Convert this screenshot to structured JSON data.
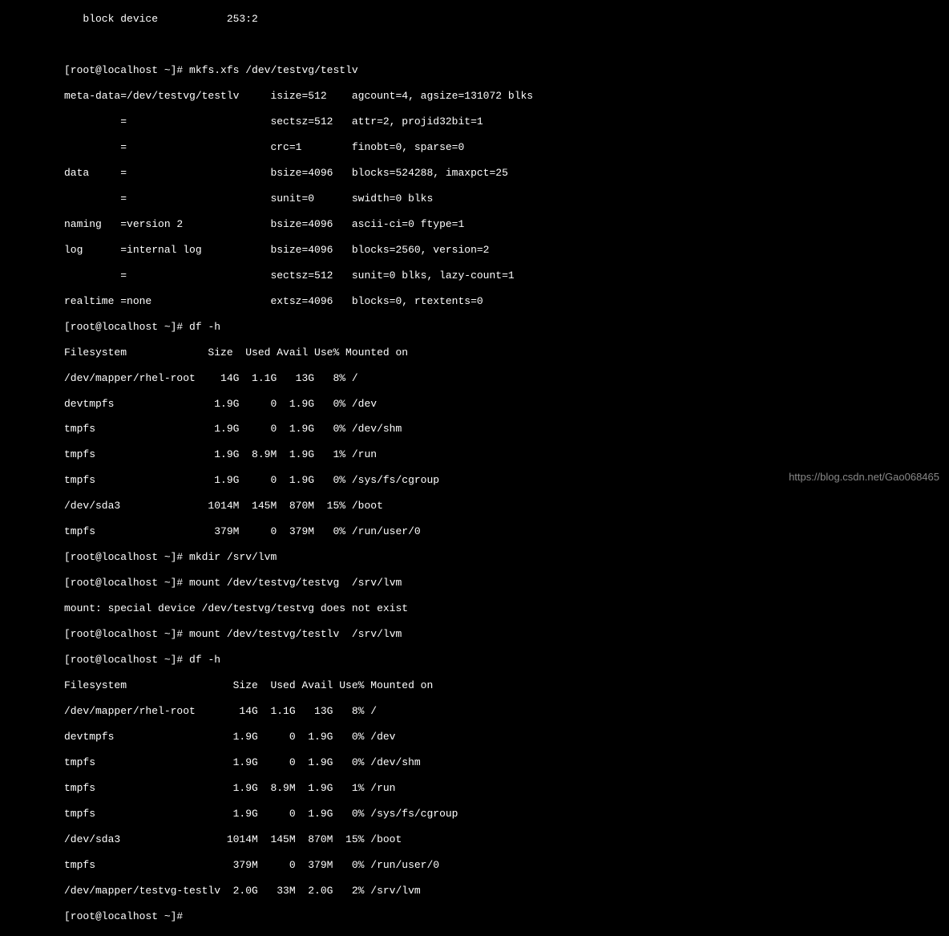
{
  "partial_top": "   block device           253:2",
  "prompt": "[root@localhost ~]#",
  "cmd1": "mkfs.xfs /dev/testvg/testlv",
  "mkfs": {
    "l1": "meta-data=/dev/testvg/testlv     isize=512    agcount=4, agsize=131072 blks",
    "l2": "         =                       sectsz=512   attr=2, projid32bit=1",
    "l3": "         =                       crc=1        finobt=0, sparse=0",
    "l4": "data     =                       bsize=4096   blocks=524288, imaxpct=25",
    "l5": "         =                       sunit=0      swidth=0 blks",
    "l6": "naming   =version 2              bsize=4096   ascii-ci=0 ftype=1",
    "l7": "log      =internal log           bsize=4096   blocks=2560, version=2",
    "l8": "         =                       sectsz=512   sunit=0 blks, lazy-count=1",
    "l9": "realtime =none                   extsz=4096   blocks=0, rtextents=0"
  },
  "cmd2": "df -h",
  "df1": {
    "header": "Filesystem             Size  Used Avail Use% Mounted on",
    "r1": "/dev/mapper/rhel-root    14G  1.1G   13G   8% /",
    "r2": "devtmpfs                1.9G     0  1.9G   0% /dev",
    "r3": "tmpfs                   1.9G     0  1.9G   0% /dev/shm",
    "r4": "tmpfs                   1.9G  8.9M  1.9G   1% /run",
    "r5": "tmpfs                   1.9G     0  1.9G   0% /sys/fs/cgroup",
    "r6": "/dev/sda3              1014M  145M  870M  15% /boot",
    "r7": "tmpfs                   379M     0  379M   0% /run/user/0"
  },
  "cmd3": "mkdir /srv/lvm",
  "cmd4": "mount /dev/testvg/testvg  /srv/lvm",
  "err1": "mount: special device /dev/testvg/testvg does not exist",
  "cmd5": "mount /dev/testvg/testlv  /srv/lvm",
  "cmd6": "df -h",
  "df2": {
    "header": "Filesystem                 Size  Used Avail Use% Mounted on",
    "r1": "/dev/mapper/rhel-root       14G  1.1G   13G   8% /",
    "r2": "devtmpfs                   1.9G     0  1.9G   0% /dev",
    "r3": "tmpfs                      1.9G     0  1.9G   0% /dev/shm",
    "r4": "tmpfs                      1.9G  8.9M  1.9G   1% /run",
    "r5": "tmpfs                      1.9G     0  1.9G   0% /sys/fs/cgroup",
    "r6": "/dev/sda3                 1014M  145M  870M  15% /boot",
    "r7": "tmpfs                      379M     0  379M   0% /run/user/0",
    "r8": "/dev/mapper/testvg-testlv  2.0G   33M  2.0G   2% /srv/lvm"
  },
  "watermark": "https://blog.csdn.net/Gao068465"
}
